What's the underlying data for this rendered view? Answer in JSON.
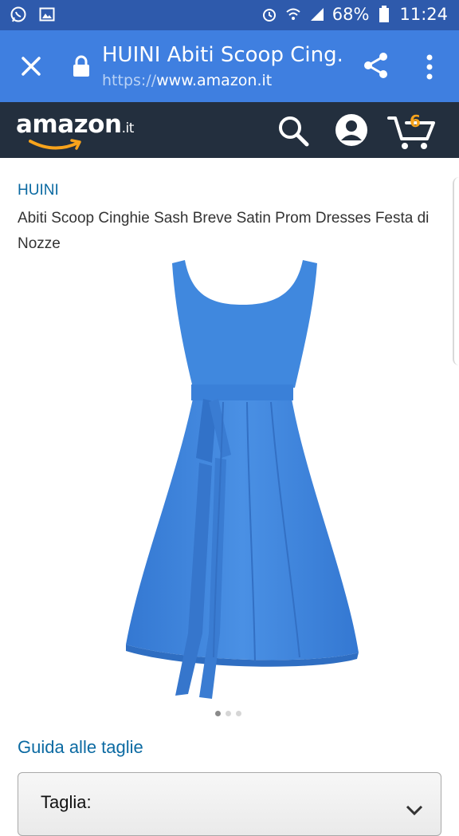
{
  "status_bar": {
    "battery": "68%",
    "time": "11:24",
    "icons": [
      "whatsapp-icon",
      "gallery-icon",
      "alarm-icon",
      "wifi-icon",
      "signal-icon",
      "battery-icon"
    ]
  },
  "browser": {
    "page_title": "HUINI Abiti Scoop Cing...",
    "url_scheme": "https://",
    "url_host": "www.amazon.it",
    "progress": 0.73
  },
  "amazon_header": {
    "logo": "amazon",
    "tld": ".it",
    "cart_count": "6",
    "colors": {
      "background": "#232f3e",
      "accent": "#f7a31c"
    }
  },
  "product": {
    "brand": "HUINI",
    "title": "Abiti Scoop Cinghie Sash Breve Satin Prom Dresses Festa di Nozze",
    "image_color": "#3d82d8",
    "carousel_total": 3,
    "carousel_active": 1
  },
  "size": {
    "guide_link": "Guida alle taglie",
    "label": "Taglia:"
  }
}
